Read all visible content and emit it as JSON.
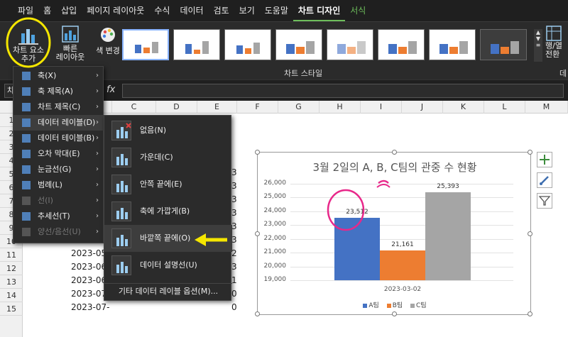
{
  "menu_tabs": [
    "파일",
    "홈",
    "삽입",
    "페이지 레이아웃",
    "수식",
    "데이터",
    "검토",
    "보기",
    "도움말",
    "차트 디자인",
    "서식"
  ],
  "ribbon": {
    "add_chart_element": "차트 요소\n추가",
    "quick_layout": "빠른\n레이아웃",
    "color_change": "색 변경",
    "styles_group": "차트 스타일",
    "row_col": "행/열\n전환",
    "group_letter": "데"
  },
  "formula_bar": {
    "fx": "fx",
    "name_box": "차"
  },
  "columns": [
    "A",
    "B",
    "C",
    "D",
    "E",
    "F",
    "G",
    "H",
    "I",
    "J",
    "K",
    "L",
    "M"
  ],
  "rows": [
    "1",
    "2",
    "3",
    "4",
    "5",
    "6",
    "7",
    "8",
    "9",
    "10",
    "11",
    "12",
    "13",
    "14",
    "15"
  ],
  "cells_b": [
    "2023-05",
    "2023-06",
    "2023-06",
    "2023-07",
    "2023-07-"
  ],
  "cells_e": [
    "3",
    "3",
    "3",
    "3",
    "3",
    "3",
    "2",
    "3",
    "1",
    "0",
    "0",
    "2",
    "2"
  ],
  "chart_menu": {
    "items": [
      {
        "label": "축(X)",
        "arrow": "›",
        "disabled": false
      },
      {
        "label": "축 제목(A)",
        "arrow": "›",
        "disabled": false
      },
      {
        "label": "차트 제목(C)",
        "arrow": "›",
        "disabled": false
      },
      {
        "label": "데이터 레이블(D)",
        "arrow": "›",
        "disabled": false
      },
      {
        "label": "데이터 테이블(B)",
        "arrow": "›",
        "disabled": false
      },
      {
        "label": "오차 막대(E)",
        "arrow": "›",
        "disabled": false
      },
      {
        "label": "눈금선(G)",
        "arrow": "›",
        "disabled": false
      },
      {
        "label": "범례(L)",
        "arrow": "›",
        "disabled": false
      },
      {
        "label": "선(I)",
        "arrow": "›",
        "disabled": true
      },
      {
        "label": "추세선(T)",
        "arrow": "›",
        "disabled": false
      },
      {
        "label": "양선/음선(U)",
        "arrow": "›",
        "disabled": true
      }
    ]
  },
  "data_label_submenu": {
    "items": [
      "없음(N)",
      "가운데(C)",
      "안쪽 끝에(E)",
      "축에 가깝게(B)",
      "바깥쪽 끝에(O)",
      "데이터 설명선(U)"
    ],
    "more": "기타 데이터 레이블 옵션(M)..."
  },
  "chart_data": {
    "type": "bar",
    "title": "3월 2일의 A, B, C팀의 관중 수 현황",
    "categories": [
      "2023-03-02"
    ],
    "series": [
      {
        "name": "A팀",
        "values": [
          23512
        ],
        "color": "#4472c4"
      },
      {
        "name": "B팀",
        "values": [
          21161
        ],
        "color": "#ed7d31"
      },
      {
        "name": "C팀",
        "values": [
          25393
        ],
        "color": "#a5a5a5"
      }
    ],
    "data_labels": [
      "23,512",
      "21,161",
      "25,393"
    ],
    "yticks": [
      "19,000",
      "20,000",
      "21,000",
      "22,000",
      "23,000",
      "24,000",
      "25,000",
      "26,000"
    ],
    "ylim": [
      19000,
      26000
    ],
    "legend": "bottom",
    "grid": true
  },
  "colors": {
    "accent": "#6dbd5b",
    "highlight": "#f5e600",
    "annotation": "#e8288a"
  }
}
